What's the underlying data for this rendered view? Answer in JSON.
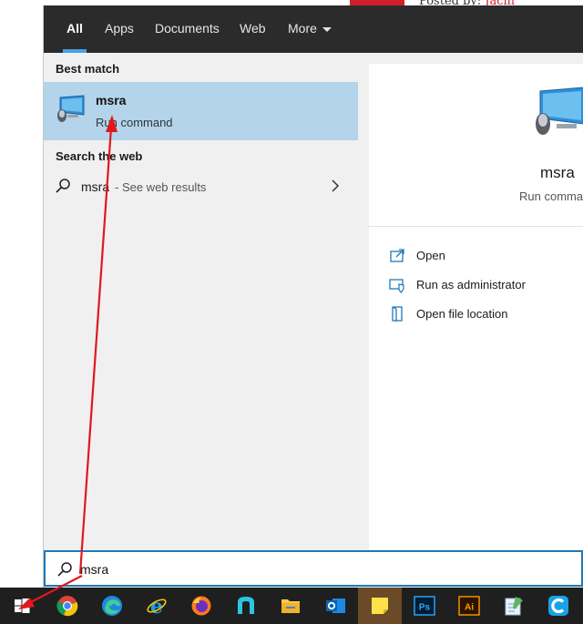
{
  "background": {
    "posted_prefix": "Posted by:",
    "posted_author": "Jacin"
  },
  "tabs": [
    {
      "label": "All",
      "active": true
    },
    {
      "label": "Apps"
    },
    {
      "label": "Documents"
    },
    {
      "label": "Web"
    },
    {
      "label": "More"
    }
  ],
  "left_pane": {
    "best_match_header": "Best match",
    "best_match": {
      "title": "msra",
      "subtitle": "Run command",
      "icon": "monitor-mouse-icon"
    },
    "search_web_header": "Search the web",
    "web_result": {
      "query": "msra",
      "suffix": "- See web results"
    }
  },
  "right_pane": {
    "title": "msra",
    "subtitle": "Run command",
    "actions": [
      {
        "label": "Open",
        "icon": "open-icon"
      },
      {
        "label": "Run as administrator",
        "icon": "shield-icon"
      },
      {
        "label": "Open file location",
        "icon": "file-location-icon"
      }
    ]
  },
  "search_box": {
    "value": "msra"
  },
  "taskbar": {
    "apps": [
      "start",
      "chrome",
      "edge",
      "internet-explorer",
      "firefox",
      "nvim",
      "file-explorer",
      "outlook",
      "sticky-notes",
      "photoshop",
      "illustrator",
      "notepad",
      "ccleaner"
    ],
    "ps_label": "Ps",
    "ai_label": "Ai"
  },
  "colors": {
    "tabbar": "#2b2b2b",
    "accent": "#4aa0e6",
    "highlight": "#b3d4ea",
    "annotation_arrow": "#e0181e"
  }
}
